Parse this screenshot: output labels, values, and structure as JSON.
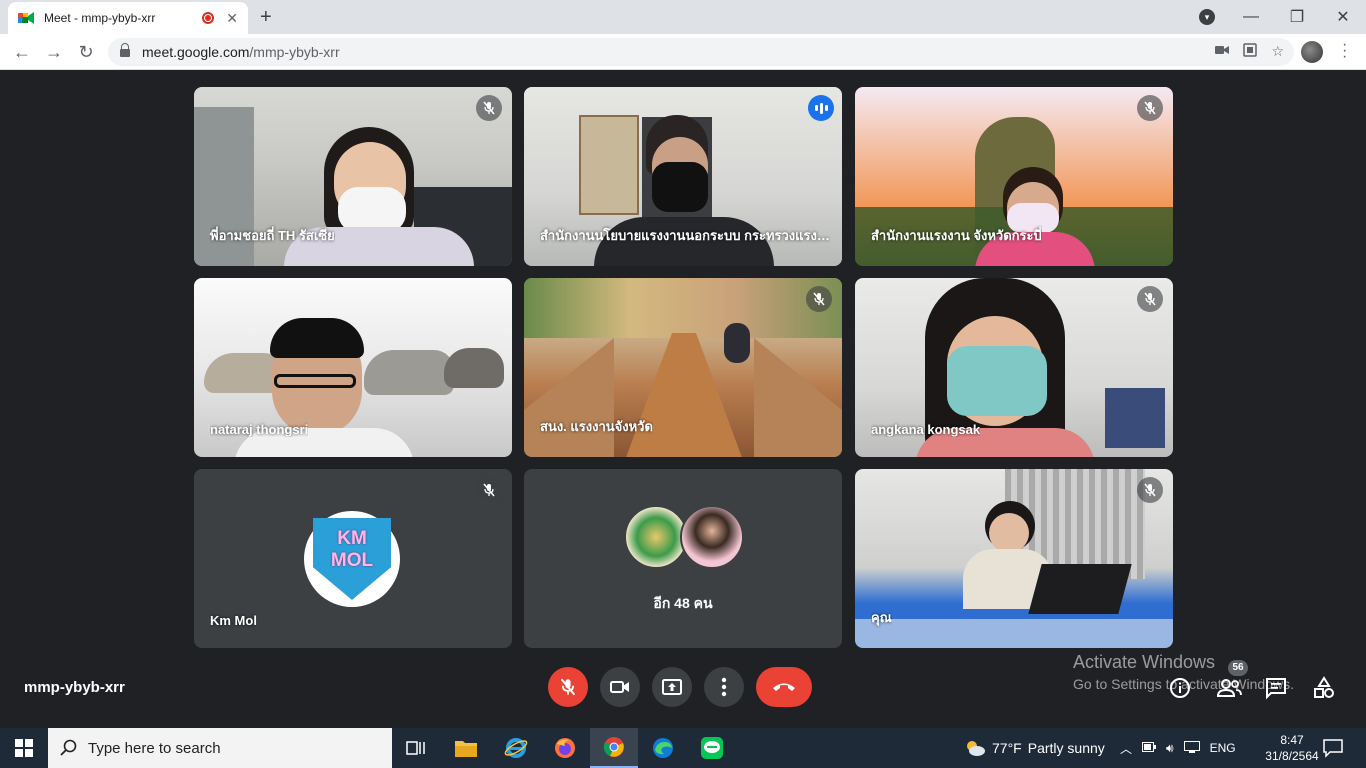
{
  "browser": {
    "tab_title": "Meet - mmp-ybyb-xrr",
    "url_host": "meet.google.com",
    "url_path": "/mmp-ybyb-xrr"
  },
  "meet": {
    "meeting_code": "mmp-ybyb-xrr",
    "participant_count": "56",
    "more_participants_label": "อีก 48 คน",
    "tiles": [
      {
        "name": "พี่อามชอยถี่ TH รัสเซีย",
        "muted": true
      },
      {
        "name": "สำนักงานนโยบายแรงงานนอกระบบ กระทรวงแรงงาน",
        "speaking": true
      },
      {
        "name": "สำนักงานแรงงาน จังหวัดกระบี่",
        "muted": true
      },
      {
        "name": "nataraj thongsri",
        "muted": false
      },
      {
        "name": "สนง. แรงงานจังหวัด",
        "muted": true
      },
      {
        "name": "angkana kongsak",
        "muted": true
      },
      {
        "name": "Km Mol",
        "muted": true,
        "logo_line1": "KM",
        "logo_line2": "MOL"
      },
      {
        "name": "",
        "muted": false
      },
      {
        "name": "คุณ",
        "muted": true
      }
    ],
    "activate_line1": "Activate Windows",
    "activate_line2": "Go to Settings to activate Windows."
  },
  "taskbar": {
    "search_placeholder": "Type here to search",
    "weather_temp": "77°F",
    "weather_text": "Partly sunny",
    "language": "ENG",
    "time": "8:47",
    "date": "31/8/2564"
  },
  "colors": {
    "meet_bg": "#202124",
    "tile_bg": "#3c4043",
    "end_call_red": "#ea4335",
    "speaking_blue": "#1a73e8"
  }
}
